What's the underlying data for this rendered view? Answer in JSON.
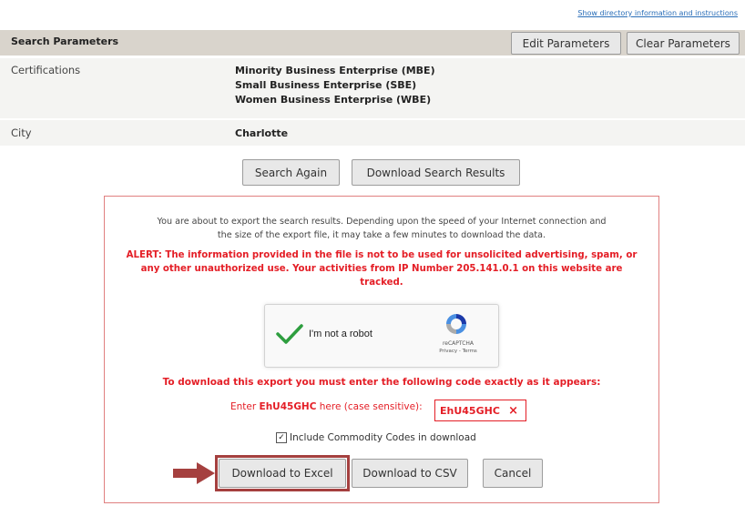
{
  "top_link": "Show directory information and instructions",
  "search_params": {
    "title": "Search Parameters",
    "edit_button": "Edit Parameters",
    "clear_button": "Clear Parameters",
    "rows": [
      {
        "label": "Certifications",
        "values": [
          "Minority Business Enterprise (MBE)",
          "Small Business Enterprise (SBE)",
          "Women Business Enterprise (WBE)"
        ]
      },
      {
        "label": "City",
        "values": [
          "Charlotte"
        ]
      }
    ]
  },
  "actions": {
    "search_again": "Search Again",
    "download_results": "Download Search Results"
  },
  "export_panel": {
    "info_line1": "You are about to export the search results. Depending upon the speed of your Internet connection and",
    "info_line2": "the size of the export file, it may take a few minutes to download the data.",
    "alert_line1": "ALERT: The information provided in the file is not to be used for unsolicited advertising, spam, or",
    "alert_line2": "any other unauthorized use. Your activities from IP Number 205.141.0.1 on this website are",
    "alert_line3": "tracked.",
    "captcha": {
      "label": "I'm not a robot",
      "brand": "reCAPTCHA",
      "links": "Privacy - Terms"
    },
    "code_instruction": "To download this export you must enter the following code exactly as it appears:",
    "enter_prefix": "Enter",
    "code": "EhU45GHC",
    "enter_suffix": "here (case sensitive):",
    "code_input_value": "EhU45GHC",
    "clear_symbol": "×",
    "include_commodity": "Include Commodity Codes in download",
    "include_commodity_checked": true,
    "buttons": {
      "excel": "Download to Excel",
      "csv": "Download to CSV",
      "cancel": "Cancel"
    }
  },
  "colors": {
    "alert": "#e41e26",
    "header_bg": "#d9d4cc",
    "arrow": "#a5403f"
  }
}
